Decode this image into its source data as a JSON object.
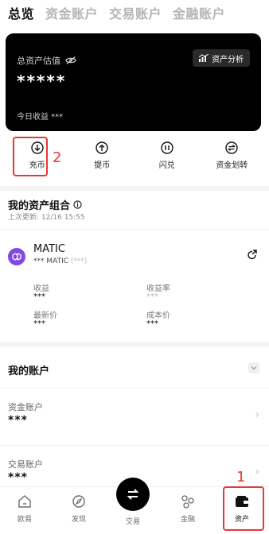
{
  "tabs": [
    "总览",
    "资金账户",
    "交易账户",
    "金融账户"
  ],
  "asset_card": {
    "label": "总资产估值",
    "value": "*****",
    "analysis_button": "资产分析",
    "today_income": "今日收益 ***"
  },
  "quick_actions": [
    {
      "label": "充币",
      "icon": "deposit-icon"
    },
    {
      "label": "提币",
      "icon": "withdraw-icon"
    },
    {
      "label": "闪兑",
      "icon": "swap-icon"
    },
    {
      "label": "资金划转",
      "icon": "transfer-icon"
    }
  ],
  "annotations": {
    "deposit_step": "2",
    "assets_step": "1"
  },
  "portfolio": {
    "title": "我的资产组合",
    "updated": "上次更新: 12/16 15:55",
    "coin": {
      "name": "MATIC",
      "sub_prefix": "*** MATIC",
      "sub_suffix": "(***)",
      "stats": {
        "income_label": "收益",
        "income_value": "***",
        "rate_label": "收益率",
        "rate_value": "***",
        "latest_label": "最新价",
        "latest_value": "***",
        "cost_label": "成本价",
        "cost_value": "***"
      }
    }
  },
  "my_accounts": {
    "title": "我的账户",
    "rows": [
      {
        "name": "资金账户",
        "value": "***"
      },
      {
        "name": "交易账户",
        "value": "***"
      }
    ]
  },
  "bottom_nav": [
    {
      "label": "欧易",
      "icon": "home-icon"
    },
    {
      "label": "发现",
      "icon": "discover-icon"
    },
    {
      "label": "交易",
      "icon": "trade-icon"
    },
    {
      "label": "金融",
      "icon": "finance-icon"
    },
    {
      "label": "资产",
      "icon": "wallet-icon"
    }
  ],
  "colors": {
    "accent": "#000000",
    "highlight": "#e53935",
    "coin": "#8247e5"
  }
}
